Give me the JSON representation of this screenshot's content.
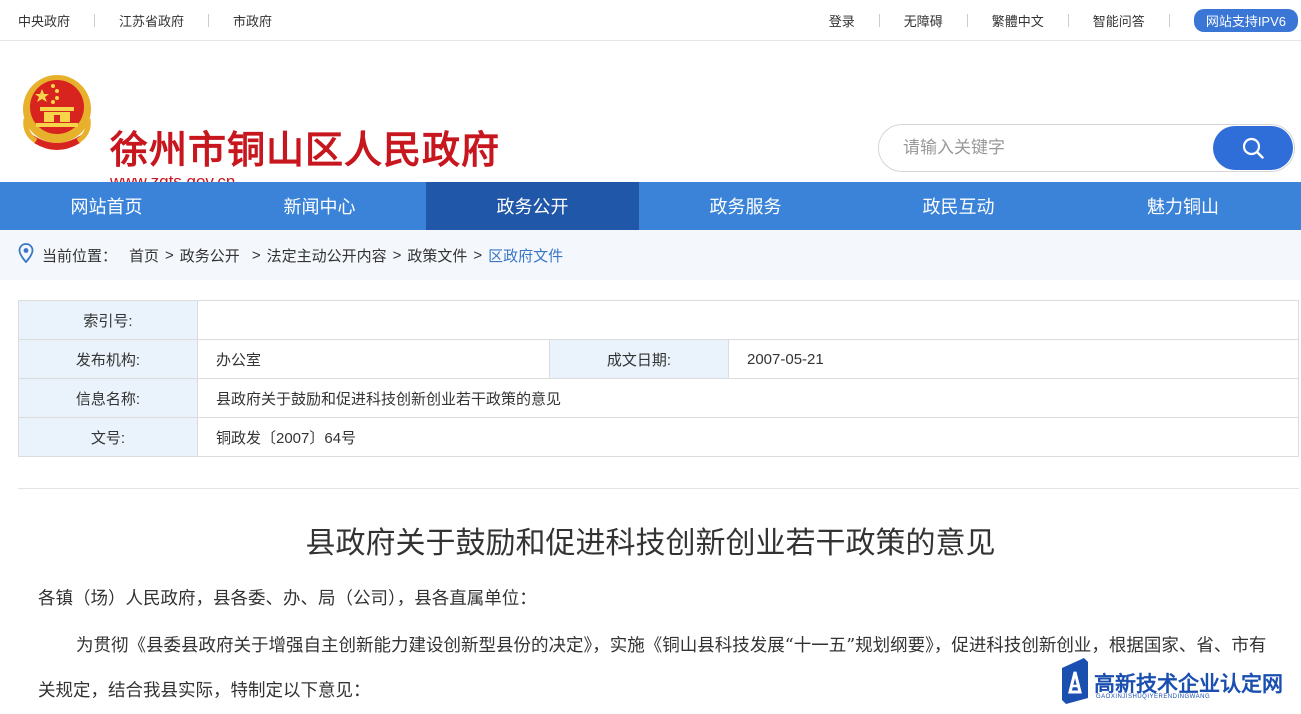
{
  "topbar": {
    "left_links": [
      "中央政府",
      "江苏省政府",
      "市政府"
    ],
    "right_links": [
      "登录",
      "无障碍",
      "繁體中文",
      "智能问答"
    ],
    "ipv6_badge": "网站支持IPV6"
  },
  "header": {
    "site_title": "徐州市铜山区人民政府",
    "site_url": "www.zgts.gov.cn",
    "emblem_icon": "national-emblem-icon",
    "search": {
      "placeholder": "请输入关键字",
      "value": "",
      "button_icon": "search-icon"
    }
  },
  "nav": {
    "items": [
      "网站首页",
      "新闻中心",
      "政务公开",
      "政务服务",
      "政民互动",
      "魅力铜山"
    ],
    "active": "政务公开"
  },
  "breadcrumb": {
    "label": "当前位置：",
    "items": [
      "首页",
      "政务公开",
      "法定主动公开内容",
      "政策文件",
      "区政府文件"
    ],
    "separator": ">"
  },
  "info_table": {
    "index_label": "索引号:",
    "index_value": "",
    "publisher_label": "发布机构:",
    "publisher_value": "办公室",
    "date_label": "成文日期:",
    "date_value": "2007-05-21",
    "name_label": "信息名称:",
    "name_value": "县政府关于鼓励和促进科技创新创业若干政策的意见",
    "docno_label": "文号:",
    "docno_value": "铜政发〔2007〕64号"
  },
  "document": {
    "title": "县政府关于鼓励和促进科技创新创业若干政策的意见",
    "salutation": "各镇（场）人民政府，县各委、办、局（公司），县各直属单位：",
    "paragraph1": "为贯彻《县委县政府关于增强自主创新能力建设创新型县份的决定》，实施《铜山县科技发展“十一五”规划纲要》，促进科技创新创业，根据国家、省、市有关规定，结合我县实际，特制定以下意见："
  },
  "watermark": {
    "text": "高新技术企业认定网",
    "subtext": "GAOXINJISHUQIYERENDINGWANG"
  },
  "colors": {
    "brand_red": "#c8161e",
    "nav_blue": "#3a83d8",
    "nav_active": "#2157a8",
    "crumb_current": "#3a76c6"
  }
}
